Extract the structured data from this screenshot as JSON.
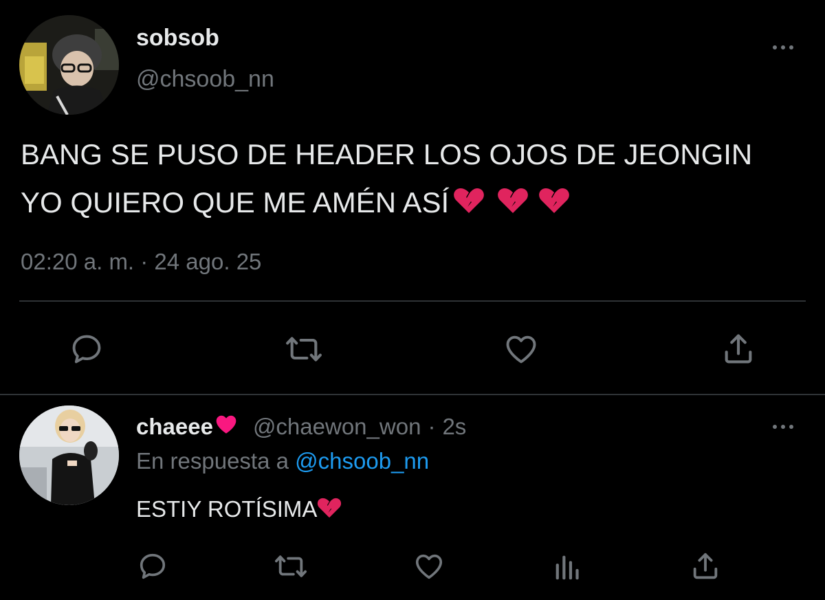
{
  "main_tweet": {
    "display_name": "sobsob",
    "handle": "@chsoob_nn",
    "text_line_1": "BANG SE PUSO DE HEADER LOS OJOS DE JEONGIN",
    "text_line_2": "YO QUIERO QUE ME AMÉN ASÍ",
    "timestamp": "02:20 a. m. · 24 ago. 25",
    "actions": [
      {
        "icon": "reply-icon"
      },
      {
        "icon": "retweet-icon"
      },
      {
        "icon": "like-icon"
      },
      {
        "icon": "share-icon"
      }
    ],
    "more_icon": "more-icon"
  },
  "reply_tweet": {
    "display_name": "chaeee",
    "handle": "@chaewon_won",
    "separator": "·",
    "age": "2s",
    "replying_prefix": "En respuesta a",
    "replying_to": "@chsoob_nn",
    "text": "ESTIY ROTÍSIMA",
    "actions": [
      {
        "icon": "reply-icon"
      },
      {
        "icon": "retweet-icon"
      },
      {
        "icon": "like-icon"
      },
      {
        "icon": "analytics-icon"
      },
      {
        "icon": "share-icon"
      }
    ],
    "more_icon": "more-icon"
  },
  "colors": {
    "background": "#000000",
    "text": "#e7e9ea",
    "secondary": "#71767b",
    "link": "#1d9bf0",
    "divider": "#2f3336",
    "broken_heart": "#e0245e",
    "red_heart": "#f91880"
  }
}
